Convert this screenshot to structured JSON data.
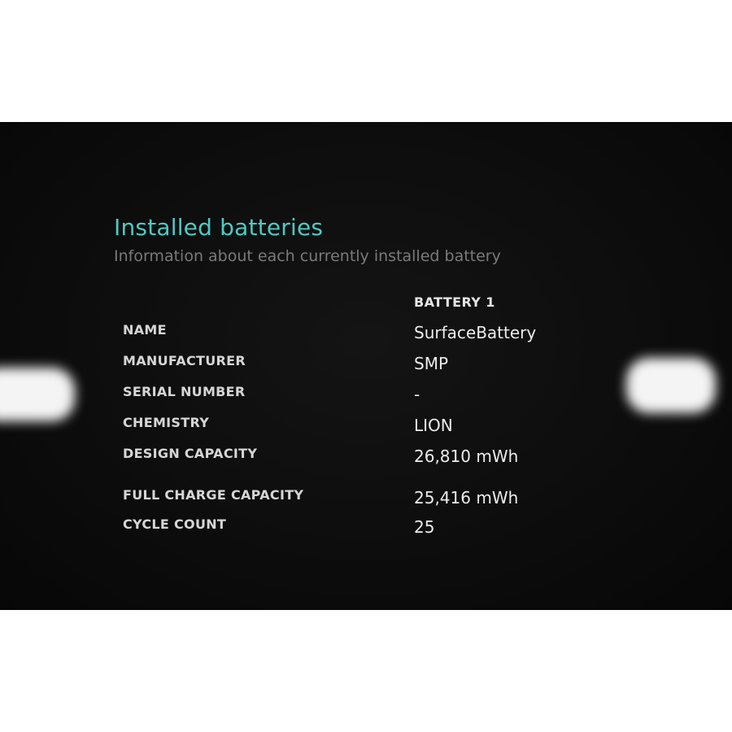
{
  "report": {
    "title": "Installed batteries",
    "subtitle": "Information about each currently installed battery",
    "column_header": "BATTERY 1",
    "rows": [
      {
        "label": "NAME",
        "value": "SurfaceBattery"
      },
      {
        "label": "MANUFACTURER",
        "value": "SMP"
      },
      {
        "label": "SERIAL NUMBER",
        "value": "-"
      },
      {
        "label": "CHEMISTRY",
        "value": "LION"
      },
      {
        "label": "DESIGN CAPACITY",
        "value": "26,810 mWh"
      },
      {
        "label": "FULL CHARGE CAPACITY",
        "value": "25,416 mWh"
      },
      {
        "label": "CYCLE COUNT",
        "value": "25"
      }
    ]
  },
  "colors": {
    "title": "#4fc9c3",
    "subtitle": "#7a7a7a",
    "background": "#0d0d0d",
    "text": "#ececec"
  }
}
